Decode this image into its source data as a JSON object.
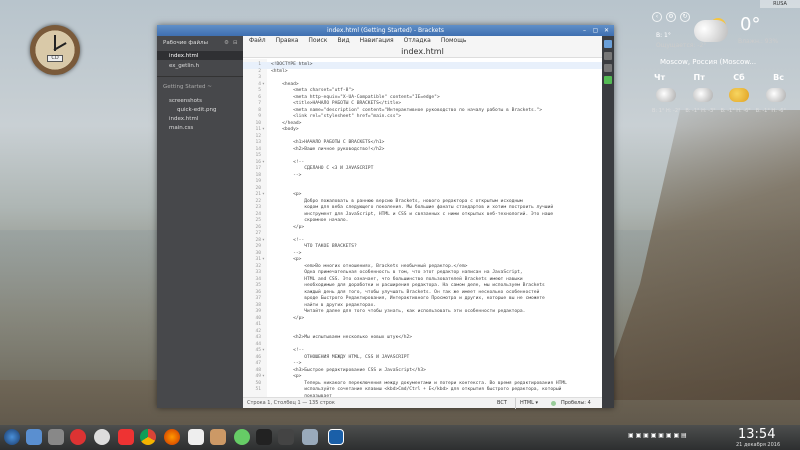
{
  "desktop": {
    "top_tab": "RUSA"
  },
  "clock_widget": {
    "display": "CD"
  },
  "weather": {
    "temp": "0°",
    "wind": "В: 1°",
    "feels": "Ощущается: -2°",
    "details": "Влажн.: 93%",
    "location": "Moscow, Россия (Moscow...",
    "days": [
      "Чт",
      "Пт",
      "Сб",
      "Вс"
    ],
    "day_temps": [
      "В: 1° Н: -2°",
      "В: -1° Н: -3°",
      "В: -1° Н: -6°",
      "В: -1° Н: -6°"
    ]
  },
  "window": {
    "title": "index.html (Getting Started) - Brackets",
    "filename": "index.html"
  },
  "sidebar": {
    "working_files_label": "Рабочие файлы",
    "working_files": [
      "index.html",
      "ex_getlin.h"
    ],
    "project_label": "Getting Started ~",
    "tree": [
      {
        "name": "screenshots",
        "indent": 1
      },
      {
        "name": "quick-edit.png",
        "indent": 2
      },
      {
        "name": "index.html",
        "indent": 1
      },
      {
        "name": "main.css",
        "indent": 1
      }
    ]
  },
  "menu": [
    "Файл",
    "Правка",
    "Поиск",
    "Вид",
    "Навигация",
    "Отладка",
    "Помощь"
  ],
  "code_lines": [
    {
      "n": "1",
      "f": "",
      "t": "<!DOCTYPE html>"
    },
    {
      "n": "2",
      "f": "",
      "t": "<html>"
    },
    {
      "n": "3",
      "f": "",
      "t": ""
    },
    {
      "n": "4",
      "f": "▾",
      "t": "    <head>"
    },
    {
      "n": "5",
      "f": "",
      "t": "        <meta charset=\"utf-8\">"
    },
    {
      "n": "6",
      "f": "",
      "t": "        <meta http-equiv=\"X-UA-Compatible\" content=\"IE=edge\">"
    },
    {
      "n": "7",
      "f": "",
      "t": "        <title>НАЧАЛО РАБОТЫ С BRACKETS</title>"
    },
    {
      "n": "8",
      "f": "",
      "t": "        <meta name=\"description\" content=\"Интерактивное руководство по началу работы в Brackets.\">"
    },
    {
      "n": "9",
      "f": "",
      "t": "        <link rel=\"stylesheet\" href=\"main.css\">"
    },
    {
      "n": "10",
      "f": "",
      "t": "    </head>"
    },
    {
      "n": "11",
      "f": "▾",
      "t": "    <body>"
    },
    {
      "n": "12",
      "f": "",
      "t": ""
    },
    {
      "n": "13",
      "f": "",
      "t": "        <h1>НАЧАЛО РАБОТЫ С BRACKETS</h1>"
    },
    {
      "n": "14",
      "f": "",
      "t": "        <h2>Ваше личное руководство!</h2>"
    },
    {
      "n": "15",
      "f": "",
      "t": ""
    },
    {
      "n": "16",
      "f": "▾",
      "t": "        <!--"
    },
    {
      "n": "17",
      "f": "",
      "t": "            СДЕЛАНО С <3 И JAVASCRIPT"
    },
    {
      "n": "18",
      "f": "",
      "t": "        -->"
    },
    {
      "n": "19",
      "f": "",
      "t": ""
    },
    {
      "n": "20",
      "f": "",
      "t": ""
    },
    {
      "n": "21",
      "f": "▾",
      "t": "        <p>"
    },
    {
      "n": "22",
      "f": "",
      "t": "            Добро пожаловать в раннюю версию Brackets, нового редактора с открытым исходным"
    },
    {
      "n": "23",
      "f": "",
      "t": "            кодом для веба следующего поколения. Мы большие фанаты стандартов и хотим построить лучший"
    },
    {
      "n": "24",
      "f": "",
      "t": "            инструмент для JavaScript, HTML и CSS и связанных с ними открытых веб-технологий. Это наше"
    },
    {
      "n": "25",
      "f": "",
      "t": "            скромное начало."
    },
    {
      "n": "26",
      "f": "",
      "t": "        </p>"
    },
    {
      "n": "27",
      "f": "",
      "t": ""
    },
    {
      "n": "28",
      "f": "▾",
      "t": "        <!--"
    },
    {
      "n": "29",
      "f": "",
      "t": "            ЧТО ТАКОЕ BRACKETS?"
    },
    {
      "n": "30",
      "f": "",
      "t": "        -->"
    },
    {
      "n": "31",
      "f": "▾",
      "t": "        <p>"
    },
    {
      "n": "32",
      "f": "",
      "t": "            <em>Во многих отношениях, Brackets необычный редактор.</em>"
    },
    {
      "n": "33",
      "f": "",
      "t": "            Одна примечательная особенность в том, что этот редактор написан на JavaScript,"
    },
    {
      "n": "34",
      "f": "",
      "t": "            HTML and CSS. Это означает, что большинство пользователей Brackets имеют навыки"
    },
    {
      "n": "35",
      "f": "",
      "t": "            необходимые для доработки и расширения редактора. На самом деле, мы используем Brackets"
    },
    {
      "n": "36",
      "f": "",
      "t": "            каждый день для того, чтобы улучшать Brackets. Он так же имеет несколько особенностей"
    },
    {
      "n": "37",
      "f": "",
      "t": "            вроде Быстрого Редактирования, Интерактивного Просмотра и других, которые вы не сможете"
    },
    {
      "n": "38",
      "f": "",
      "t": "            найти в других редакторах."
    },
    {
      "n": "39",
      "f": "",
      "t": "            Читайте далее для того чтобы узнать, как использовать эти особенности редактора."
    },
    {
      "n": "40",
      "f": "",
      "t": "        </p>"
    },
    {
      "n": "41",
      "f": "",
      "t": ""
    },
    {
      "n": "42",
      "f": "",
      "t": ""
    },
    {
      "n": "43",
      "f": "",
      "t": "        <h2>Мы испытываем несколько новых штук</h2>"
    },
    {
      "n": "44",
      "f": "",
      "t": ""
    },
    {
      "n": "45",
      "f": "▾",
      "t": "        <!--"
    },
    {
      "n": "46",
      "f": "",
      "t": "            ОТНОШЕНИЯ МЕЖДУ HTML, CSS И JAVASCRIPT"
    },
    {
      "n": "47",
      "f": "",
      "t": "        -->"
    },
    {
      "n": "48",
      "f": "",
      "t": "        <h3>Быстрое редактирование CSS и JavaScript</h3>"
    },
    {
      "n": "49",
      "f": "▾",
      "t": "        <p>"
    },
    {
      "n": "50",
      "f": "",
      "t": "            Теперь никакого переключения между документами и потери контекста. Во время редактирования HTML"
    },
    {
      "n": "51",
      "f": "",
      "t": "            используйте сочетание клавиш <kbd>Cmd/Ctrl + E</kbd> для открытия быстрого редактора, который"
    },
    {
      "n": "",
      "f": "",
      "t": "            показывает"
    },
    {
      "n": "",
      "f": "",
      "t": "            все связанные с этой строкой CSS. Сделайте изменение CSS-стилей, нажмите <kbd>ESC</kbd> и"
    },
    {
      "n": "52",
      "f": "",
      "t": ""
    }
  ],
  "status": {
    "position": "Строка 1, Столбец 1 — 135 строк",
    "ins": "ВСТ",
    "mode": "HTML ▾",
    "spaces": "Пробелы: 4"
  },
  "taskbar": {
    "time": "13:54",
    "date": "21 декабря 2016"
  }
}
